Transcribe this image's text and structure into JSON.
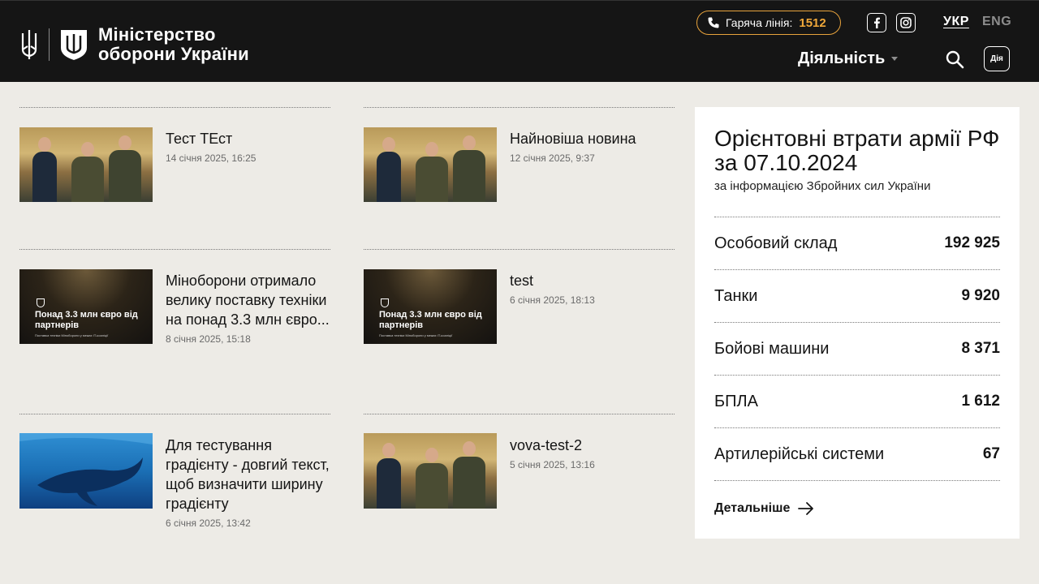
{
  "header": {
    "logo_line1": "Міністерство",
    "logo_line2": "оборони України",
    "hotline_label": "Гаряча лінія:",
    "hotline_number": "1512",
    "social": {
      "facebook_icon": "facebook-icon",
      "instagram_icon": "instagram-icon"
    },
    "lang_ukr": "УКР",
    "lang_eng": "ENG",
    "nav_activity": "Діяльність",
    "diia_label": "Дія",
    "colors": {
      "background": "#151515",
      "accent": "#f0a83a"
    }
  },
  "news": [
    {
      "title": "Тест ТЕст",
      "date": "14 січня 2025, 16:25",
      "thumb": "team-photo"
    },
    {
      "title": "Найновіша новина",
      "date": "12 січня 2025, 9:37",
      "thumb": "team-photo"
    },
    {
      "title": "Міноборони отримало велику поставку техніки на понад 3.3 млн євро...",
      "date": "8 січня 2025, 15:18",
      "thumb": "hangar-photo",
      "thumb_text": "Понад 3.3 млн євро від партнерів",
      "thumb_caption": "Поставка техніки Міноборони у межах IT-коаліції"
    },
    {
      "title": "test",
      "date": "6 січня 2025, 18:13",
      "thumb": "hangar-photo",
      "thumb_text": "Понад 3.3 млн євро від партнерів",
      "thumb_caption": "Поставка техніки Міноборони у межах IT-коаліції"
    },
    {
      "title": "Для тестування градієнту - довгий текст, щоб визначити ширину градієнту",
      "date": "6 січня 2025, 13:42",
      "thumb": "whale-photo"
    },
    {
      "title": "vova-test-2",
      "date": "5 січня 2025, 13:16",
      "thumb": "team-photo"
    }
  ],
  "losses": {
    "title": "Орієнтовні втрати армії РФ за 07.10.2024",
    "subtitle": "за інформацією Збройних сил України",
    "rows": [
      {
        "label": "Особовий склад",
        "value": "192 925"
      },
      {
        "label": "Танки",
        "value": "9 920"
      },
      {
        "label": "Бойові машини",
        "value": "8 371"
      },
      {
        "label": "БПЛА",
        "value": "1 612"
      },
      {
        "label": "Артилерійські системи",
        "value": "67"
      }
    ],
    "more": "Детальніше"
  }
}
